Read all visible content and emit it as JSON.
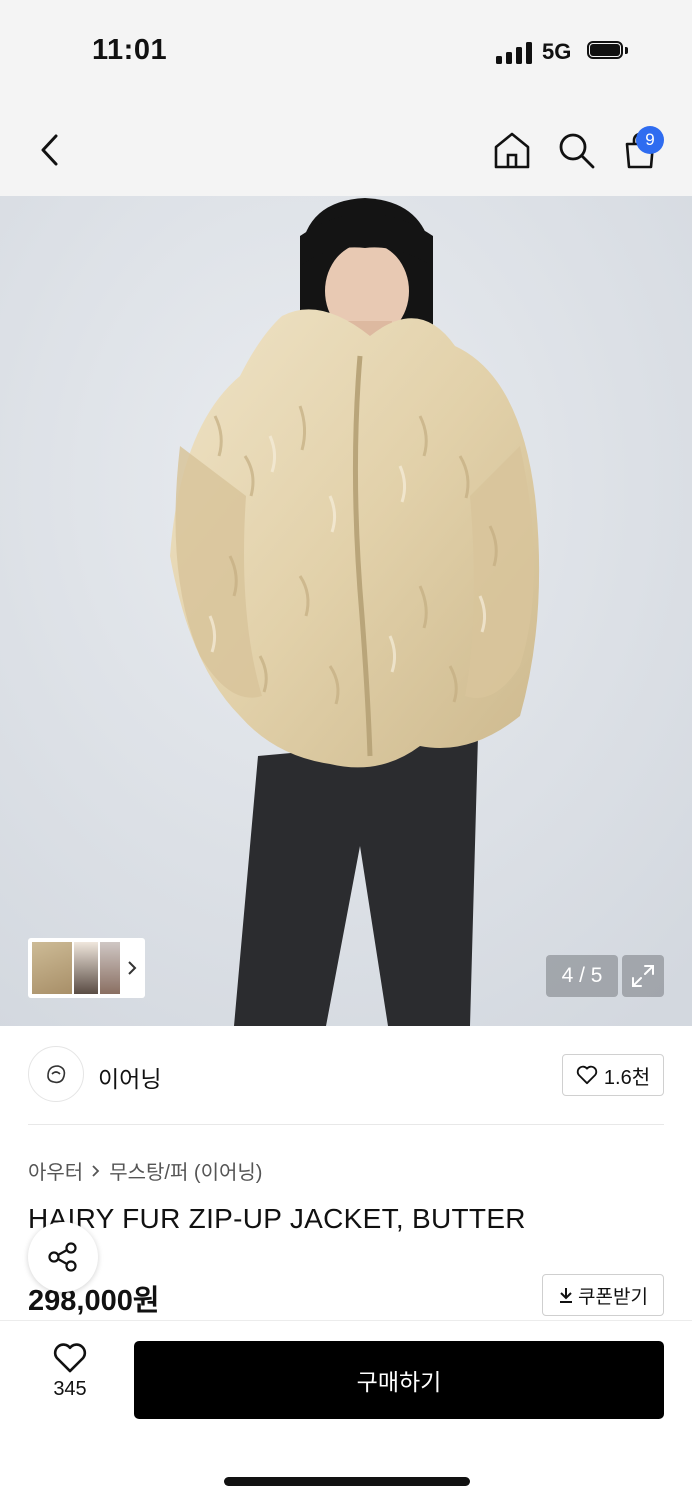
{
  "status_bar": {
    "time": "11:01",
    "network": "5G"
  },
  "header": {
    "cart_count": "9",
    "icons": [
      "back-icon",
      "home-icon",
      "search-icon",
      "cart-icon"
    ]
  },
  "gallery": {
    "counter": "4 / 5",
    "image_desc": "model wearing beige shaggy fur jacket and dark knit pants"
  },
  "brand": {
    "name": "이어닝",
    "likes": "1.6천"
  },
  "product": {
    "breadcrumb": [
      "아우터",
      "무스탕/퍼 (이어닝)"
    ],
    "title": "HAIRY FUR ZIP-UP JACKET, BUTTER",
    "price": "298,000원",
    "coupon_label": "쿠폰받기"
  },
  "bottom": {
    "wish_count": "345",
    "buy_label": "구매하기"
  },
  "colors": {
    "badge": "#2f6cf0",
    "buy_button": "#000000",
    "fur": "#e2d2ae"
  }
}
